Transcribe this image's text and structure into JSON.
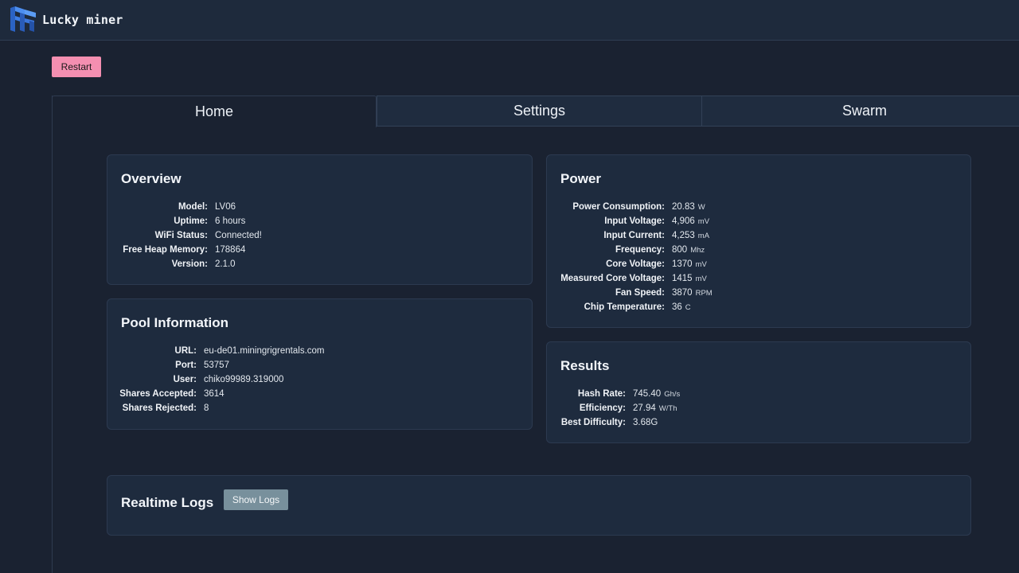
{
  "brand": {
    "name": "Lucky miner"
  },
  "actions": {
    "restart_label": "Restart"
  },
  "tabs": [
    {
      "label": "Home",
      "active": true
    },
    {
      "label": "Settings",
      "active": false
    },
    {
      "label": "Swarm",
      "active": false
    }
  ],
  "overview": {
    "title": "Overview",
    "rows": [
      {
        "key": "Model:",
        "value": "LV06"
      },
      {
        "key": "Uptime:",
        "value": "6 hours"
      },
      {
        "key": "WiFi Status:",
        "value": "Connected!"
      },
      {
        "key": "Free Heap Memory:",
        "value": "178864"
      },
      {
        "key": "Version:",
        "value": "2.1.0"
      }
    ]
  },
  "pool": {
    "title": "Pool Information",
    "rows": [
      {
        "key": "URL:",
        "value": "eu-de01.miningrigrentals.com"
      },
      {
        "key": "Port:",
        "value": "53757"
      },
      {
        "key": "User:",
        "value": "chiko99989.319000"
      },
      {
        "key": "Shares Accepted:",
        "value": "3614"
      },
      {
        "key": "Shares Rejected:",
        "value": "8"
      }
    ]
  },
  "power": {
    "title": "Power",
    "rows": [
      {
        "key": "Power Consumption:",
        "value": "20.83",
        "unit": "W"
      },
      {
        "key": "Input Voltage:",
        "value": "4,906",
        "unit": "mV"
      },
      {
        "key": "Input Current:",
        "value": "4,253",
        "unit": "mA"
      },
      {
        "key": "Frequency:",
        "value": "800",
        "unit": "Mhz"
      },
      {
        "key": "Core Voltage:",
        "value": "1370",
        "unit": "mV"
      },
      {
        "key": "Measured Core Voltage:",
        "value": "1415",
        "unit": "mV"
      },
      {
        "key": "Fan Speed:",
        "value": "3870",
        "unit": "RPM"
      },
      {
        "key": "Chip Temperature:",
        "value": "36",
        "unit": "C"
      }
    ]
  },
  "results": {
    "title": "Results",
    "rows": [
      {
        "key": "Hash Rate:",
        "value": "745.40",
        "unit": "Gh/s"
      },
      {
        "key": "Efficiency:",
        "value": "27.94",
        "unit": "W/Th"
      },
      {
        "key": "Best Difficulty:",
        "value": "3.68G"
      }
    ]
  },
  "logs": {
    "title": "Realtime Logs",
    "show_logs_label": "Show Logs"
  },
  "colors": {
    "page_bg": "#1a2231",
    "card_bg": "#1e2b3e",
    "restart_button": "#f48fb1",
    "show_logs_button": "#78909c",
    "logo_blue": "#2f6fd6"
  }
}
